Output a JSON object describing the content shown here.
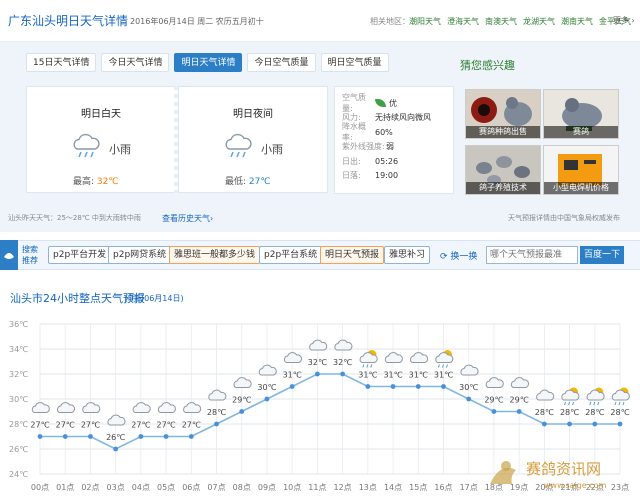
{
  "header": {
    "title": "广东汕头明日天气详情",
    "date": "2016年06月14日  周二  农历五月初十",
    "region_label": "相关地区：",
    "regions": [
      "潮阳天气",
      "澄海天气",
      "南澳天气",
      "龙湖天气",
      "潮南天气",
      "金平天气"
    ],
    "more": "更多 ›"
  },
  "tabs": [
    "15日天气详情",
    "今日天气详情",
    "明日天气详情",
    "今日空气质量",
    "明日空气质量"
  ],
  "day": {
    "title": "明日白天",
    "condition": "小雨",
    "temp_label": "最高:",
    "temp": "32℃",
    "icon": "cloud-rain-icon"
  },
  "night": {
    "title": "明日夜间",
    "condition": "小雨",
    "temp_label": "最低:",
    "temp": "27℃",
    "icon": "cloud-rain-icon"
  },
  "info": [
    {
      "label": "空气质量:",
      "value": "优"
    },
    {
      "label": "风力:",
      "value": "无持续风向微风"
    },
    {
      "label": "降水概率:",
      "value": "60%"
    },
    {
      "label": "紫外线强度:",
      "value": "弱"
    },
    {
      "label": "日出:",
      "value": "05:26"
    },
    {
      "label": "日落:",
      "value": "19:00"
    }
  ],
  "footer": {
    "left": "汕头昨天天气：25～28℃  中到大雨转中雨",
    "link": "查看历史天气›",
    "right": "天气预报详情由中国气象局权威发布"
  },
  "guess": {
    "title": "猜您感兴趣",
    "items": [
      "赛鸽种鸽出售",
      "赛鸽",
      "鸽子养殖技术",
      "小型电焊机价格"
    ]
  },
  "search": {
    "label": "搜索推荐",
    "keywords": [
      "p2p平台开发",
      "p2p网贷系统",
      "雅思班一般都多少钱",
      "p2p平台系统",
      "明日天气预报",
      "雅思补习"
    ],
    "refresh": "换一换",
    "placeholder": "哪个天气预报最准",
    "button": "百度一下"
  },
  "chart_title": "汕头市24小时整点天气预报",
  "chart_subtitle": "(明日06月14日)",
  "chart_data": {
    "type": "line",
    "categories": [
      "00点",
      "01点",
      "02点",
      "03点",
      "04点",
      "05点",
      "06点",
      "07点",
      "08点",
      "09点",
      "10点",
      "11点",
      "12点",
      "13点",
      "14点",
      "15点",
      "16点",
      "17点",
      "18点",
      "19点",
      "20点",
      "21点",
      "22点",
      "23点"
    ],
    "values": [
      27,
      27,
      27,
      26,
      27,
      27,
      27,
      28,
      29,
      30,
      31,
      32,
      32,
      31,
      31,
      31,
      31,
      30,
      29,
      29,
      28,
      28,
      28,
      28
    ],
    "value_labels": [
      "27℃",
      "27℃",
      "27℃",
      "26℃",
      "27℃",
      "27℃",
      "27℃",
      "28℃",
      "29℃",
      "30℃",
      "31℃",
      "32℃",
      "32℃",
      "31℃",
      "31℃",
      "31℃",
      "31℃",
      "30℃",
      "29℃",
      "29℃",
      "28℃",
      "28℃",
      "28℃",
      "28℃"
    ],
    "icons": [
      "cloud",
      "cloud",
      "cloud",
      "cloud",
      "cloud",
      "cloud",
      "cloud",
      "cloud",
      "cloud",
      "cloud",
      "cloud",
      "cloud",
      "cloud",
      "sun-cloud-rain",
      "cloud",
      "cloud",
      "sun-cloud-rain",
      "cloud",
      "cloud",
      "cloud",
      "cloud",
      "sun-cloud-rain",
      "sun-cloud-rain",
      "sun-cloud-rain"
    ],
    "y_ticks": [
      "24℃",
      "26℃",
      "28℃",
      "30℃",
      "32℃",
      "34℃",
      "36℃"
    ],
    "ylim": [
      24,
      36
    ],
    "grid": true,
    "line_color": "#7fb7e4",
    "point_color": "#4a90d9"
  },
  "watermark": {
    "text": "赛鸽资讯网",
    "url": "www.saige.com"
  }
}
